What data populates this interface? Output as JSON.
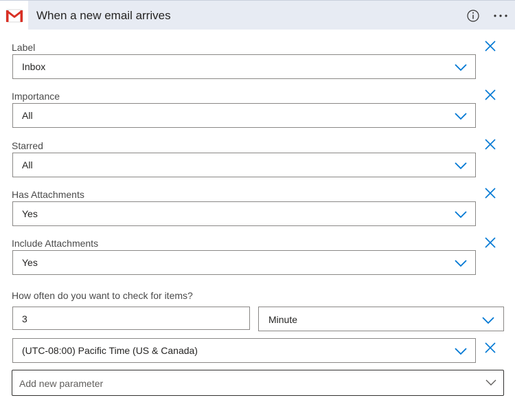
{
  "header": {
    "title": "When a new email arrives",
    "brand_color": "#D93025",
    "icons": [
      "gmail-icon",
      "info-icon",
      "more-icon"
    ]
  },
  "fields": [
    {
      "label": "Label",
      "value": "Inbox"
    },
    {
      "label": "Importance",
      "value": "All"
    },
    {
      "label": "Starred",
      "value": "All"
    },
    {
      "label": "Has Attachments",
      "value": "Yes"
    },
    {
      "label": "Include Attachments",
      "value": "Yes"
    }
  ],
  "interval": {
    "label": "How often do you want to check for items?",
    "count": "3",
    "frequency": "Minute"
  },
  "timezone": {
    "value": "(UTC-08:00) Pacific Time (US & Canada)"
  },
  "add_parameter": {
    "placeholder": "Add new parameter"
  },
  "colors": {
    "accent": "#0078D4",
    "border": "#8A8886",
    "header_bg": "#E7EBF3"
  }
}
